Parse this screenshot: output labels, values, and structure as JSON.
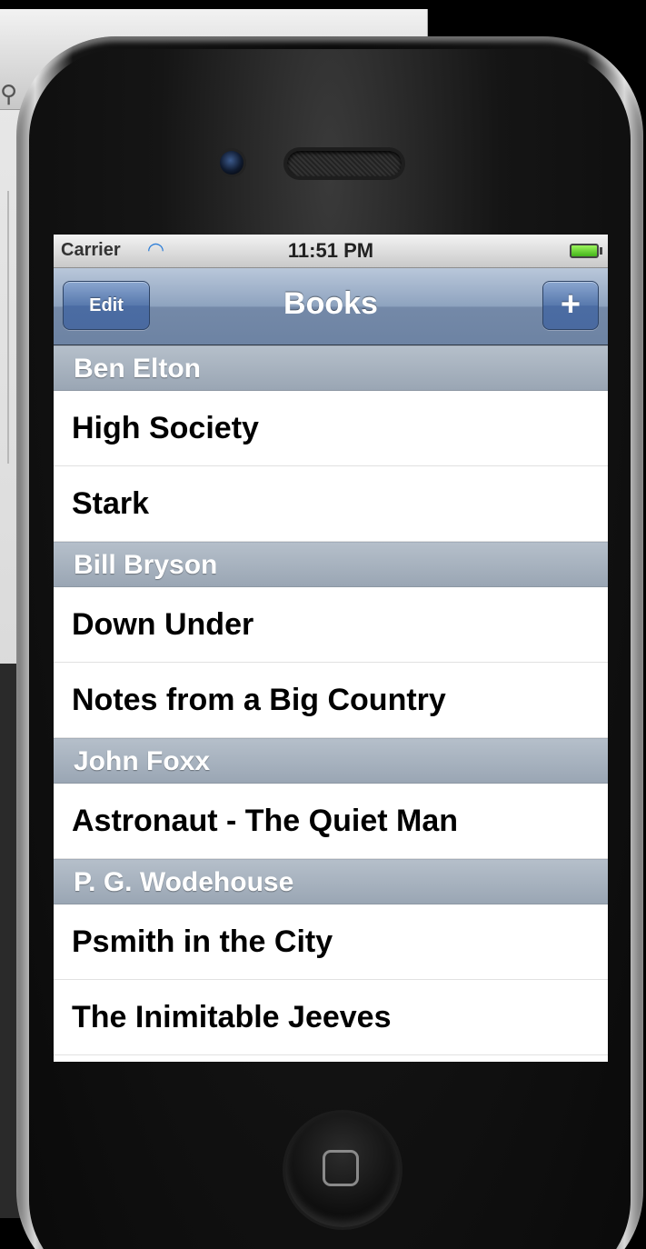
{
  "status_bar": {
    "carrier": "Carrier",
    "time": "11:51 PM",
    "wifi_icon": "wifi-icon",
    "battery_icon": "battery-icon"
  },
  "nav": {
    "title": "Books",
    "edit_label": "Edit",
    "add_label": "+"
  },
  "sections": [
    {
      "author": "Ben Elton",
      "books": [
        "High Society",
        "Stark"
      ]
    },
    {
      "author": "Bill Bryson",
      "books": [
        "Down Under",
        "Notes from a Big Country"
      ]
    },
    {
      "author": "John Foxx",
      "books": [
        "Astronaut - The Quiet Man"
      ]
    },
    {
      "author": "P. G. Wodehouse",
      "books": [
        "Psmith in the City",
        "The Inimitable Jeeves"
      ]
    }
  ],
  "colors": {
    "nav_bar": "#8ea3bf",
    "nav_button": "#5879ad",
    "section_header": "#a8b3c0"
  }
}
